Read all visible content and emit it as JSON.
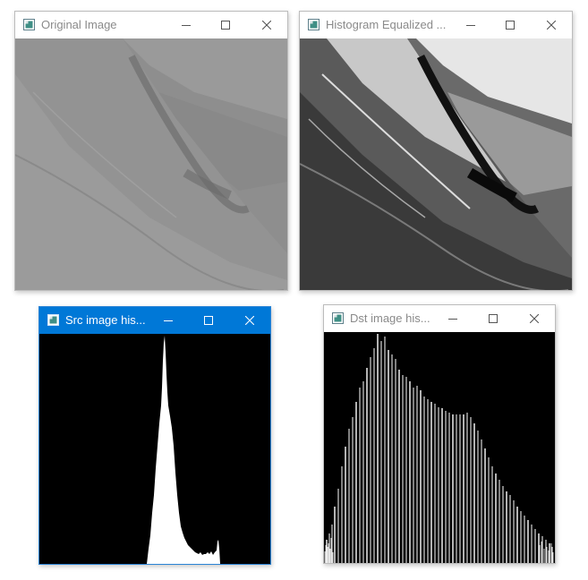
{
  "windows": [
    {
      "id": "original",
      "title": "Original Image",
      "active": false,
      "content": "photo-original"
    },
    {
      "id": "equalized",
      "title": "Histogram Equalized ...",
      "active": false,
      "content": "photo-equalized"
    },
    {
      "id": "src-hist",
      "title": "Src image his...",
      "active": true,
      "content": "histogram-source"
    },
    {
      "id": "dst-hist",
      "title": "Dst image his...",
      "active": false,
      "content": "histogram-equalized"
    }
  ],
  "colors": {
    "active_title_bg": "#0078d7",
    "inactive_title_text": "#8a8a8a",
    "histogram_bg": "#000000",
    "histogram_fill": "#ffffff"
  },
  "icons": {
    "app": "opencv-window-icon",
    "minimize": "minimize-icon",
    "maximize": "maximize-icon",
    "close": "close-icon"
  }
}
